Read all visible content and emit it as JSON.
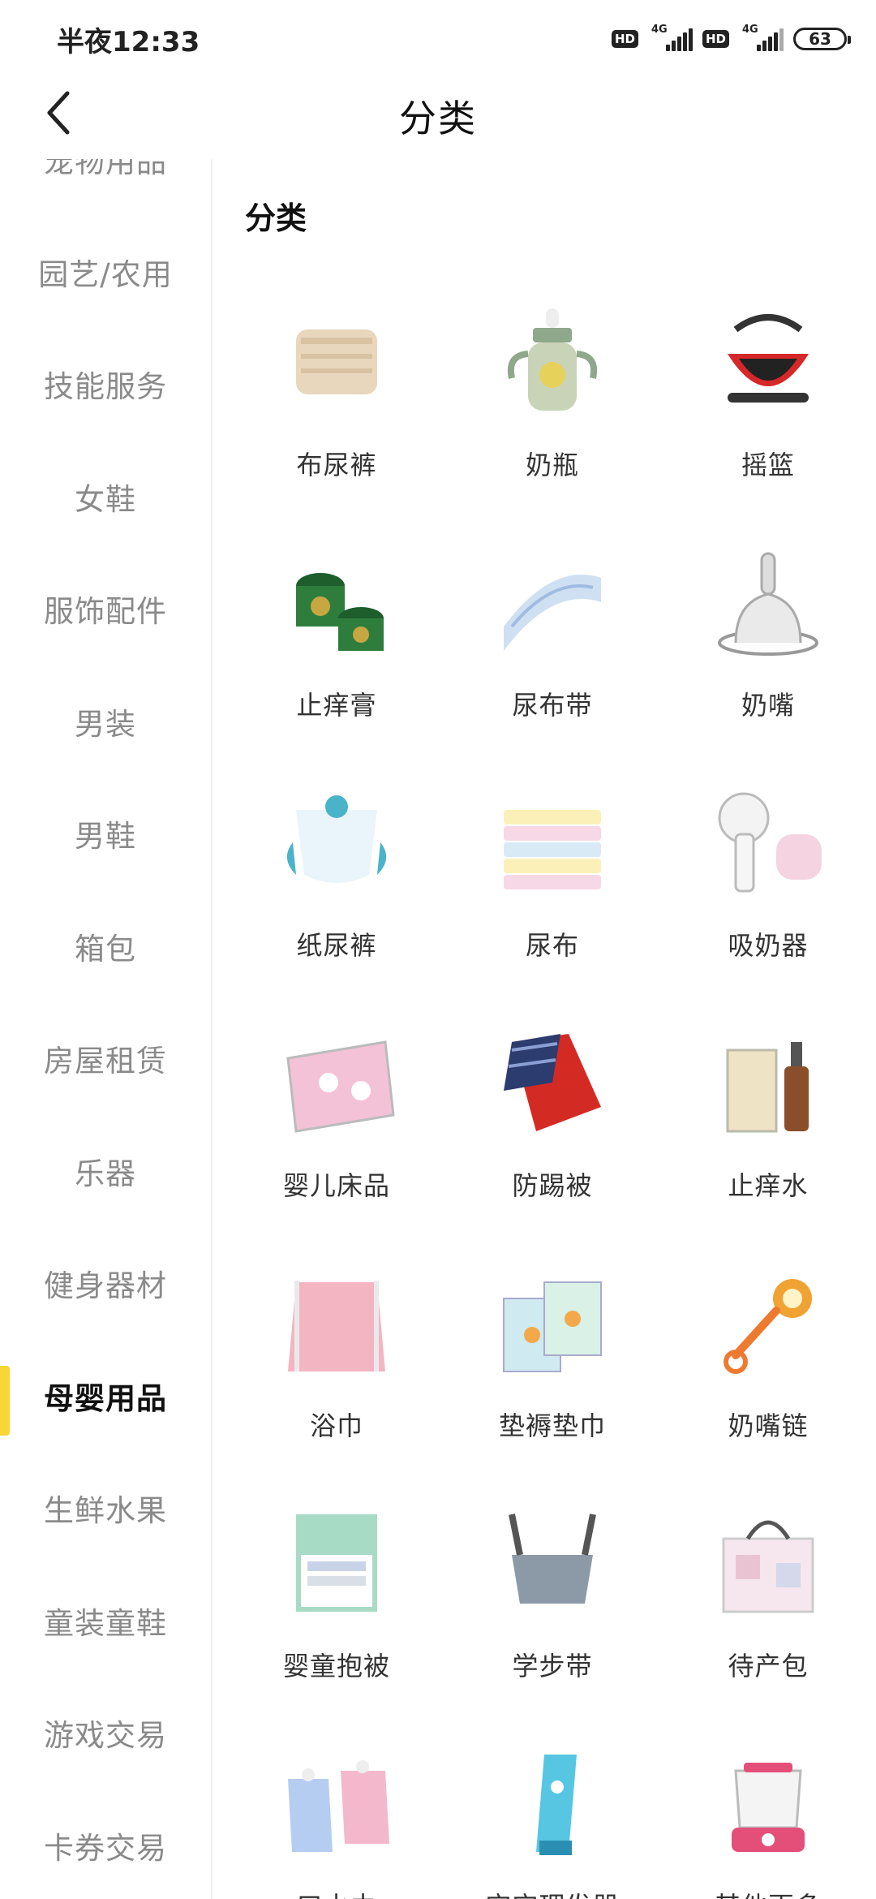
{
  "status_bar": {
    "time": "半夜12:33",
    "hd_label": "HD",
    "network": "4G",
    "battery": "63"
  },
  "header": {
    "title": "分类"
  },
  "sidebar": {
    "active_index": 12,
    "items": [
      {
        "label": "宠物用品"
      },
      {
        "label": "园艺/农用"
      },
      {
        "label": "技能服务"
      },
      {
        "label": "女鞋"
      },
      {
        "label": "服饰配件"
      },
      {
        "label": "男装"
      },
      {
        "label": "男鞋"
      },
      {
        "label": "箱包"
      },
      {
        "label": "房屋租赁"
      },
      {
        "label": "乐器"
      },
      {
        "label": "健身器材"
      },
      {
        "label": "母婴用品"
      },
      {
        "label": "生鲜水果"
      },
      {
        "label": "童装童鞋"
      },
      {
        "label": "游戏交易"
      },
      {
        "label": "卡券交易"
      }
    ]
  },
  "content": {
    "section_title": "分类",
    "categories": [
      {
        "label": "布尿裤",
        "icon": "cloth-diaper-icon"
      },
      {
        "label": "奶瓶",
        "icon": "baby-bottle-icon"
      },
      {
        "label": "摇篮",
        "icon": "car-seat-cradle-icon"
      },
      {
        "label": "止痒膏",
        "icon": "balm-jar-icon"
      },
      {
        "label": "尿布带",
        "icon": "diaper-belt-icon"
      },
      {
        "label": "奶嘴",
        "icon": "nipple-icon"
      },
      {
        "label": "纸尿裤",
        "icon": "paper-diaper-icon"
      },
      {
        "label": "尿布",
        "icon": "diaper-stack-icon"
      },
      {
        "label": "吸奶器",
        "icon": "breast-pump-icon"
      },
      {
        "label": "婴儿床品",
        "icon": "crib-bedding-icon"
      },
      {
        "label": "防踢被",
        "icon": "sleeping-bag-icon"
      },
      {
        "label": "止痒水",
        "icon": "spray-bottle-icon"
      },
      {
        "label": "浴巾",
        "icon": "bath-towel-icon"
      },
      {
        "label": "垫褥垫巾",
        "icon": "changing-pad-icon"
      },
      {
        "label": "奶嘴链",
        "icon": "pacifier-chain-icon"
      },
      {
        "label": "婴童抱被",
        "icon": "swaddle-box-icon"
      },
      {
        "label": "学步带",
        "icon": "walking-harness-icon"
      },
      {
        "label": "待产包",
        "icon": "maternity-bag-icon"
      },
      {
        "label": "口水巾",
        "icon": "bib-icon"
      },
      {
        "label": "宝宝理发器",
        "icon": "hair-clipper-icon"
      },
      {
        "label": "其他更多",
        "icon": "bottle-warmer-icon"
      }
    ]
  },
  "colors": {
    "accent": "#f9d535",
    "sidebar_text": "#8a8a8a",
    "active_text": "#111111"
  }
}
